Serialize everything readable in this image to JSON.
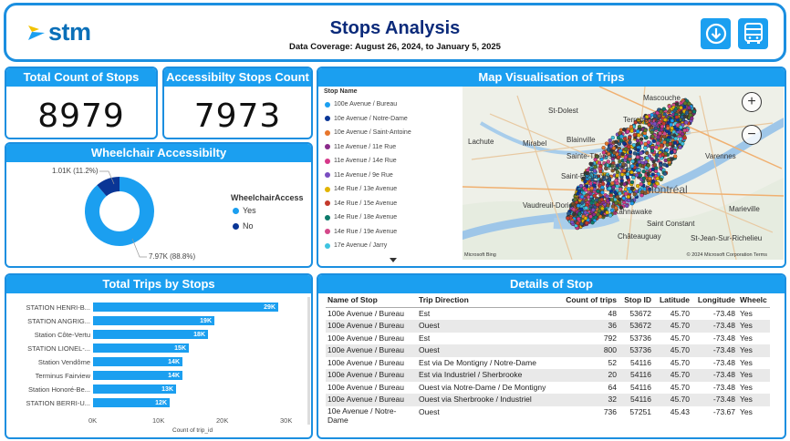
{
  "header": {
    "logo_text": "stm",
    "title": "Stops Analysis",
    "subtitle": "Data Coverage: August 26, 2024, to January 5, 2025",
    "buttons": [
      "download-icon",
      "bus-icon"
    ]
  },
  "kpis": {
    "total_title": "Total Count of Stops",
    "total_value": "8979",
    "access_title": "Accessibilty Stops Count",
    "access_value": "7973"
  },
  "wheelchair": {
    "title": "Wheelchair Accessibilty",
    "legend_title": "WheelchairAccess",
    "slices": [
      {
        "label": "Yes",
        "value": 7970,
        "display": "7.97K (88.8%)",
        "color": "#1b9ff0"
      },
      {
        "label": "No",
        "value": 1010,
        "display": "1.01K (11.2%)",
        "color": "#0a3696"
      }
    ]
  },
  "map": {
    "title": "Map Visualisation of Trips",
    "legend_header": "Stop Name",
    "legend_items": [
      {
        "label": "100e Avenue / Bureau",
        "color": "#1b9ff0"
      },
      {
        "label": "10e Avenue / Notre-Dame",
        "color": "#0a3696"
      },
      {
        "label": "10e Avenue / Saint-Antoine",
        "color": "#e8762b"
      },
      {
        "label": "11e Avenue / 11e Rue",
        "color": "#8a2a8a"
      },
      {
        "label": "11e Avenue / 14e Rue",
        "color": "#d6388a"
      },
      {
        "label": "11e Avenue / 9e Rue",
        "color": "#7a4ec0"
      },
      {
        "label": "14e Rue / 13e Avenue",
        "color": "#e2b400"
      },
      {
        "label": "14e Rue / 15e Avenue",
        "color": "#c43a2b"
      },
      {
        "label": "14e Rue / 18e Avenue",
        "color": "#0d7a6a"
      },
      {
        "label": "14e Rue / 19e Avenue",
        "color": "#d4488a"
      },
      {
        "label": "17e Avenue / Jarry",
        "color": "#3ec4e0"
      }
    ],
    "labels": [
      "Mascouche",
      "St-Dolest",
      "Terrebonne",
      "Lachute",
      "Mirabel",
      "Blainville",
      "Sainte-Thérèse",
      "Laval",
      "Saint-Eustache",
      "Montréal",
      "Vaudreuil-Dorion",
      "Kahnawake",
      "Saint Constant",
      "Châteauguay",
      "Varennes",
      "Marieville",
      "St-Jean-Sur-Richelieu"
    ],
    "attribution_left": "Microsoft Bing",
    "attribution_right": "© 2024 Microsoft Corporation  Terms"
  },
  "trips_chart": {
    "title": "Total Trips by Stops",
    "xlabel": "Count of trip_id",
    "x_ticks": [
      "0K",
      "10K",
      "20K",
      "30K"
    ],
    "xlim": [
      0,
      30000
    ]
  },
  "chart_data": {
    "type": "bar",
    "orientation": "horizontal",
    "categories": [
      "STATION HENRI-B...",
      "STATION ANGRIG...",
      "Station Côte-Vertu",
      "STATION LIONEL-...",
      "Station Vendôme",
      "Terminus Fairview",
      "Station Honoré-Be...",
      "STATION BERRI-U..."
    ],
    "values": [
      29000,
      19000,
      18000,
      15000,
      14000,
      14000,
      13000,
      12000
    ],
    "labels": [
      "29K",
      "19K",
      "18K",
      "15K",
      "14K",
      "14K",
      "13K",
      "12K"
    ],
    "xlabel": "Count of trip_id",
    "xlim": [
      0,
      30000
    ]
  },
  "details": {
    "title": "Details of Stop",
    "columns": [
      "Name of Stop",
      "Trip Direction",
      "Count of trips",
      "Stop ID",
      "Latitude",
      "Longitude",
      "Wheelc"
    ],
    "rows": [
      [
        "100e Avenue / Bureau",
        "Est",
        "48",
        "53672",
        "45.70",
        "-73.48",
        "Yes"
      ],
      [
        "100e Avenue / Bureau",
        "Ouest",
        "36",
        "53672",
        "45.70",
        "-73.48",
        "Yes"
      ],
      [
        "100e Avenue / Bureau",
        "Est",
        "792",
        "53736",
        "45.70",
        "-73.48",
        "Yes"
      ],
      [
        "100e Avenue / Bureau",
        "Ouest",
        "800",
        "53736",
        "45.70",
        "-73.48",
        "Yes"
      ],
      [
        "100e Avenue / Bureau",
        "Est via De Montigny / Notre-Dame",
        "52",
        "54116",
        "45.70",
        "-73.48",
        "Yes"
      ],
      [
        "100e Avenue / Bureau",
        "Est via Industriel / Sherbrooke",
        "20",
        "54116",
        "45.70",
        "-73.48",
        "Yes"
      ],
      [
        "100e Avenue / Bureau",
        "Ouest via Notre-Dame / De Montigny",
        "64",
        "54116",
        "45.70",
        "-73.48",
        "Yes"
      ],
      [
        "100e Avenue / Bureau",
        "Ouest via Sherbrooke / Industriel",
        "32",
        "54116",
        "45.70",
        "-73.48",
        "Yes"
      ],
      [
        "10e Avenue / Notre-Dame",
        "Ouest",
        "736",
        "57251",
        "45.43",
        "-73.67",
        "Yes"
      ]
    ]
  }
}
